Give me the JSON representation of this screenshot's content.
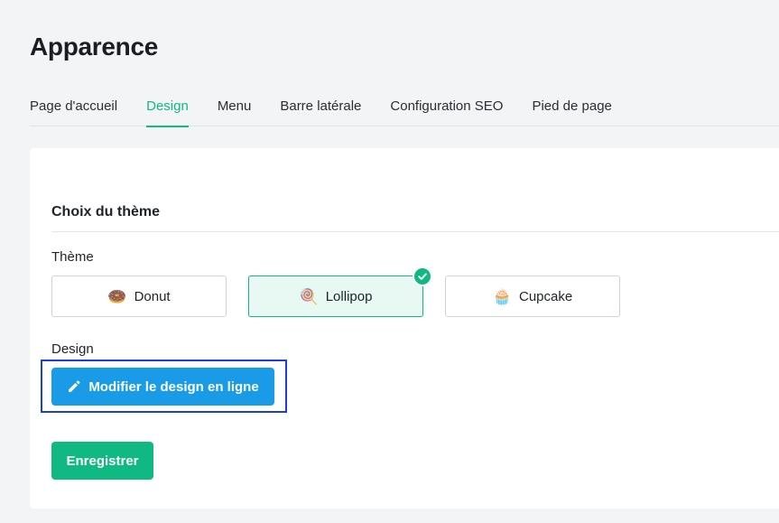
{
  "page": {
    "title": "Apparence"
  },
  "tabs": [
    {
      "label": "Page d'accueil",
      "active": false
    },
    {
      "label": "Design",
      "active": true
    },
    {
      "label": "Menu",
      "active": false
    },
    {
      "label": "Barre latérale",
      "active": false
    },
    {
      "label": "Configuration SEO",
      "active": false
    },
    {
      "label": "Pied de page",
      "active": false
    }
  ],
  "theme_section": {
    "title": "Choix du thème",
    "theme_label": "Thème",
    "options": [
      {
        "emoji": "🍩",
        "label": "Donut",
        "selected": false
      },
      {
        "emoji": "🍭",
        "label": "Lollipop",
        "selected": true
      },
      {
        "emoji": "🧁",
        "label": "Cupcake",
        "selected": false
      }
    ],
    "design_label": "Design",
    "edit_button_label": "Modifier le design en ligne",
    "edit_button_icon": "pencil-icon",
    "selected_check_icon": "check-circle-icon"
  },
  "save_button_label": "Enregistrer",
  "colors": {
    "accent_green": "#10b981",
    "primary_blue": "#1a9be8",
    "highlight_border": "#1a3fd6",
    "selected_bg": "#e8f8f2"
  }
}
